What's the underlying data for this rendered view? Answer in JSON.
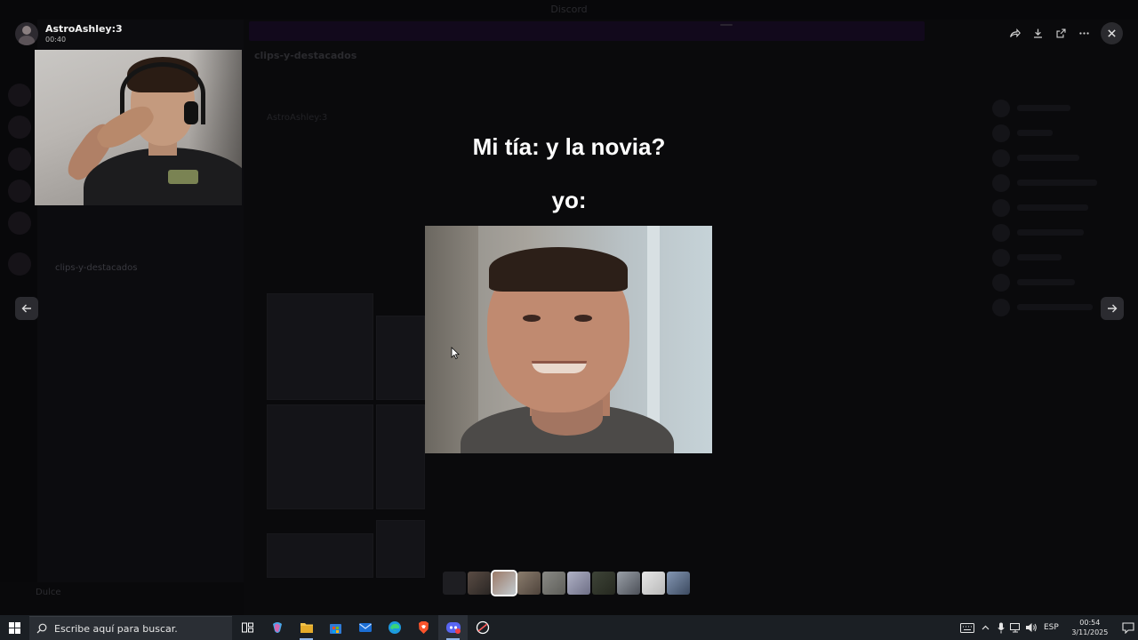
{
  "viewer": {
    "user_name": "AstroAshley:3",
    "timestamp": "00:40",
    "meme_line1": "Mi tía: y la novia?",
    "meme_line2": "yo:",
    "actions": [
      "forward-icon",
      "download-icon",
      "open-external-icon",
      "more-icon"
    ],
    "close_icon": "close-icon",
    "prev_icon": "arrow-left-icon",
    "next_icon": "arrow-right-icon",
    "thumbnails_count": 10,
    "active_thumbnail_index": 2
  },
  "background": {
    "app_title": "Discord",
    "channel_header": "clips-y-destacados",
    "chat_author": "AstroAshley:3",
    "user_panel_name": "Dulce"
  },
  "taskbar": {
    "search_placeholder": "Escribe aquí para buscar.",
    "apps": [
      "task-view-icon",
      "copilot-icon",
      "file-explorer-icon",
      "store-icon",
      "mail-icon",
      "edge-icon",
      "brave-icon",
      "discord-icon",
      "app-icon"
    ],
    "language": "ESP",
    "time": "00:54",
    "date": "3/11/2025"
  },
  "colors": {
    "accent": "#8fb4e6",
    "taskbar": "#1b1f24",
    "overlay_bg": "#000000"
  }
}
